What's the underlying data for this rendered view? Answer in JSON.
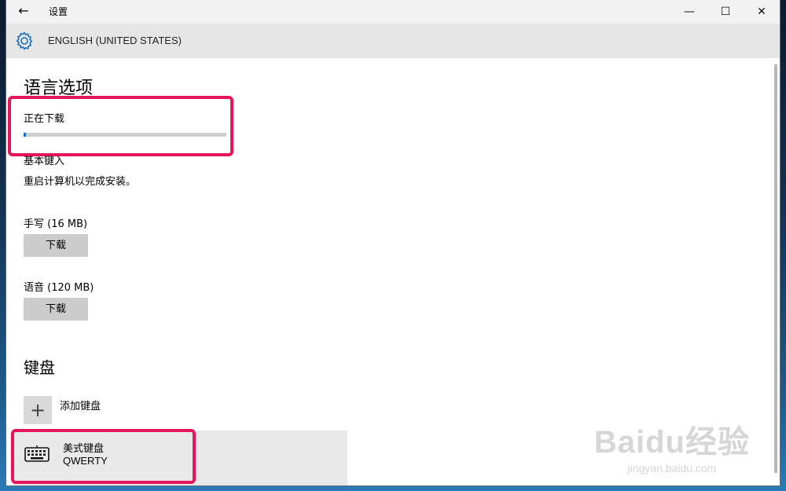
{
  "window": {
    "title": "设置",
    "minimize_symbol": "—",
    "maximize_symbol": "☐",
    "close_symbol": "✕",
    "back_symbol": "←"
  },
  "header": {
    "title": "ENGLISH (UNITED STATES)",
    "icon": "gear-icon"
  },
  "language_options": {
    "heading": "语言选项",
    "downloading_label": "正在下载",
    "download_progress": 0.01,
    "basic_typing_label": "基本键入",
    "restart_message": "重启计算机以完成安装。",
    "handwriting_label": "手写 (16 MB)",
    "handwriting_button": "下载",
    "speech_label": "语音 (120 MB)",
    "speech_button": "下载"
  },
  "keyboards": {
    "heading": "键盘",
    "add_label": "添加键盘",
    "add_icon_symbol": "+",
    "items": [
      {
        "name": "美式键盘",
        "layout": "QWERTY",
        "icon": "keyboard-icon"
      }
    ]
  },
  "watermark": {
    "brand": "Baidu经验",
    "url": "jingyan.baidu.com"
  },
  "colors": {
    "accent": "#1a6fbf",
    "highlight": "#e6155a"
  }
}
